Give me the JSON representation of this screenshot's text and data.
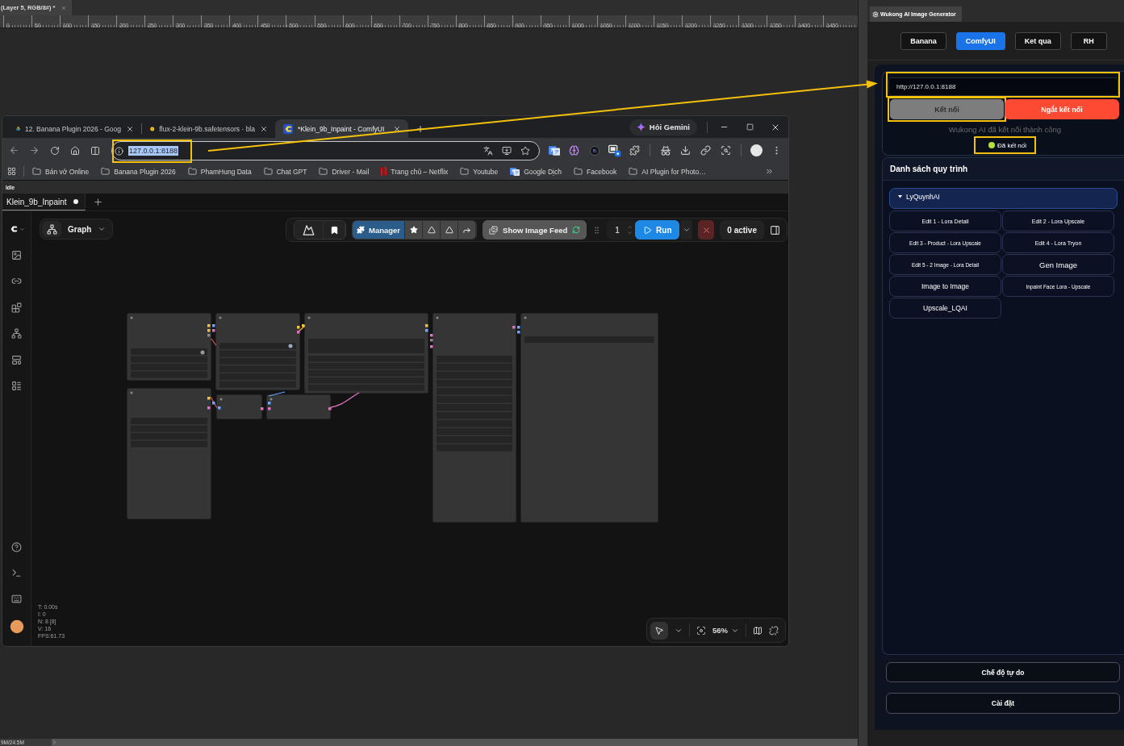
{
  "photoshop": {
    "document_tab": {
      "title": "(Layer 5, RGB/8#) *"
    },
    "ruler_labels": [
      "0",
      "50",
      "100",
      "150",
      "200",
      "250",
      "300",
      "350",
      "400",
      "450",
      "500",
      "550",
      "600",
      "650",
      "700",
      "750",
      "800",
      "850",
      "900",
      "950",
      "1000",
      "1050",
      "1100",
      "1150",
      "1200",
      "1250",
      "1300",
      "1350",
      "1400",
      "1450"
    ],
    "status_bar": {
      "memory": "9M/24.5M"
    }
  },
  "browser": {
    "tabs": [
      {
        "title": "12. Banana Plugin 2026 - Goog",
        "kind": "drive",
        "selected": false
      },
      {
        "title": "flux-2-klein-9b.safetensors · bla",
        "kind": "smiley",
        "selected": false
      },
      {
        "title": "*Klein_9b_Inpaint - ComfyUI",
        "kind": "comfy",
        "selected": true
      }
    ],
    "gemini_button": "Hỏi Gemini",
    "address": {
      "value": "127.0.0.1:8188",
      "text_selected": true,
      "highlighted": true
    },
    "bookmarks": [
      {
        "label": "Bán vở Online",
        "kind": "folder"
      },
      {
        "label": "Banana Plugin 2026",
        "kind": "folder"
      },
      {
        "label": "PhamHung Data",
        "kind": "folder"
      },
      {
        "label": "Chat GPT",
        "kind": "folder"
      },
      {
        "label": "Driver - Mail",
        "kind": "folder"
      },
      {
        "label": "Trang chủ – Netflix",
        "kind": "video"
      },
      {
        "label": "Youtube",
        "kind": "folder"
      },
      {
        "label": "Google Dịch",
        "kind": "translate"
      },
      {
        "label": "Facebook",
        "kind": "folder"
      },
      {
        "label": "AI Plugin for Photo…",
        "kind": "folder"
      }
    ]
  },
  "comfyui": {
    "status": "Idle",
    "workflow_tabs": [
      {
        "label": "Klein_9b_Inpaint",
        "modified": true,
        "selected": true
      }
    ],
    "view_button": "Graph",
    "toolbar": {
      "manager": "Manager",
      "image_feed": "Show Image Feed",
      "batch_count": "1",
      "run": "Run",
      "active_count": "0 active"
    },
    "stats": [
      "T: 0.00s",
      "I: 0",
      "N: 8 [8]",
      "V: 16",
      "FPS:61.73"
    ],
    "canvas_controls": {
      "pointer_selected": true,
      "zoom": "56%"
    }
  },
  "plugin": {
    "window_title": "Wukong AI Image Generator",
    "tabs": [
      {
        "label": "Banana",
        "selected": false
      },
      {
        "label": "ComfyUI",
        "selected": true
      },
      {
        "label": "Ket qua",
        "selected": false
      },
      {
        "label": "RH",
        "selected": false
      }
    ],
    "connection": {
      "url": {
        "value": "http://127.0.0.1:8188",
        "highlighted": true
      },
      "connect_button": {
        "label": "Kết nối",
        "disabled": true,
        "highlighted": true
      },
      "disconnect_button": {
        "label": "Ngắt kết nối"
      },
      "message": "Wukong AI đã kết nối thành công",
      "status": {
        "label": "Đã kết nối",
        "connected": true,
        "highlighted": true
      }
    },
    "workflows": {
      "title": "Danh sách quy trình",
      "groups": [
        {
          "name": "LyQuynhAI",
          "expanded": true,
          "items": [
            "Edit 1 - Lora Detail",
            "Edit 2 - Lora Upscale",
            "Edit 3 - Product - Lora Upscale",
            "Edit 4 - Lora Tryon",
            "Edit 5 - 2 Image - Lora Detail",
            "Gen Image",
            "Image to Image",
            "Inpaint Face Lora - Upscale",
            "Upscale_LQAI"
          ]
        }
      ]
    },
    "buttons": [
      "Chế độ tự do",
      "Cài đặt"
    ]
  }
}
